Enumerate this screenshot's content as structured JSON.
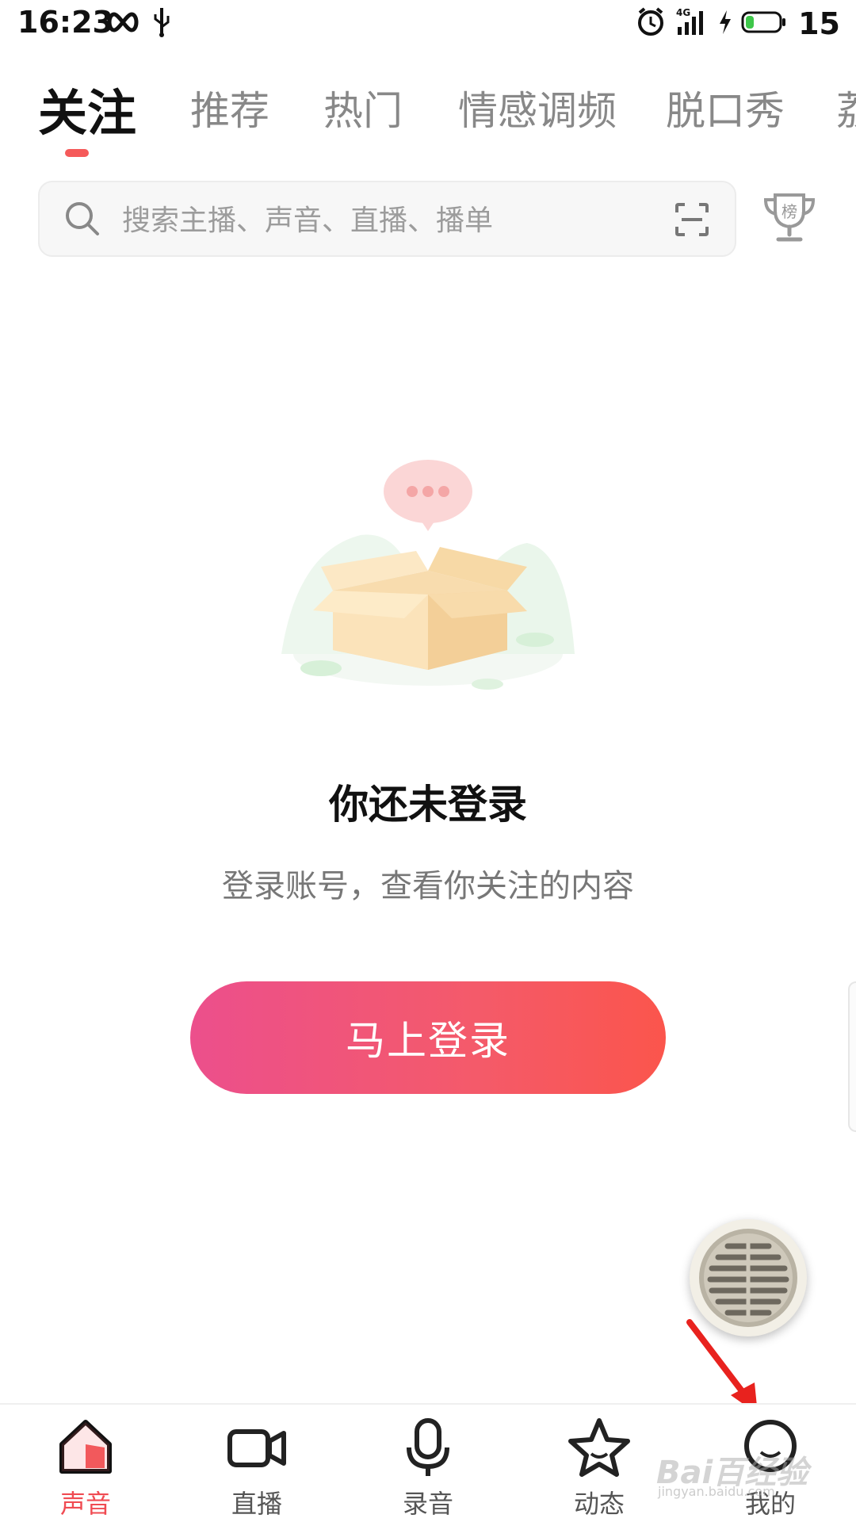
{
  "status_bar": {
    "time": "16:23",
    "battery_level": "15",
    "network": "4G"
  },
  "tabs": [
    {
      "label": "关注",
      "active": true
    },
    {
      "label": "推荐",
      "active": false
    },
    {
      "label": "热门",
      "active": false
    },
    {
      "label": "情感调频",
      "active": false
    },
    {
      "label": "脱口秀",
      "active": false
    },
    {
      "label": "荔",
      "active": false
    }
  ],
  "search": {
    "placeholder": "搜索主播、声音、直播、播单"
  },
  "ranking_icon_text": "榜",
  "empty_state": {
    "title": "你还未登录",
    "subtitle": "登录账号，查看你关注的内容",
    "button_label": "马上登录"
  },
  "bottom_nav": [
    {
      "label": "声音",
      "icon": "home-icon",
      "active": true
    },
    {
      "label": "直播",
      "icon": "video-camera-icon",
      "active": false
    },
    {
      "label": "录音",
      "icon": "microphone-icon",
      "active": false
    },
    {
      "label": "动态",
      "icon": "star-icon",
      "active": false
    },
    {
      "label": "我的",
      "icon": "profile-icon",
      "active": false
    }
  ],
  "watermark": {
    "text": "Bai百经验",
    "sub": "jingyan.baidu.com"
  },
  "colors": {
    "accent": "#f04b52",
    "button_gradient_start": "#ec4f8c",
    "button_gradient_end": "#fb554c",
    "annotation_arrow": "#e8221e"
  }
}
